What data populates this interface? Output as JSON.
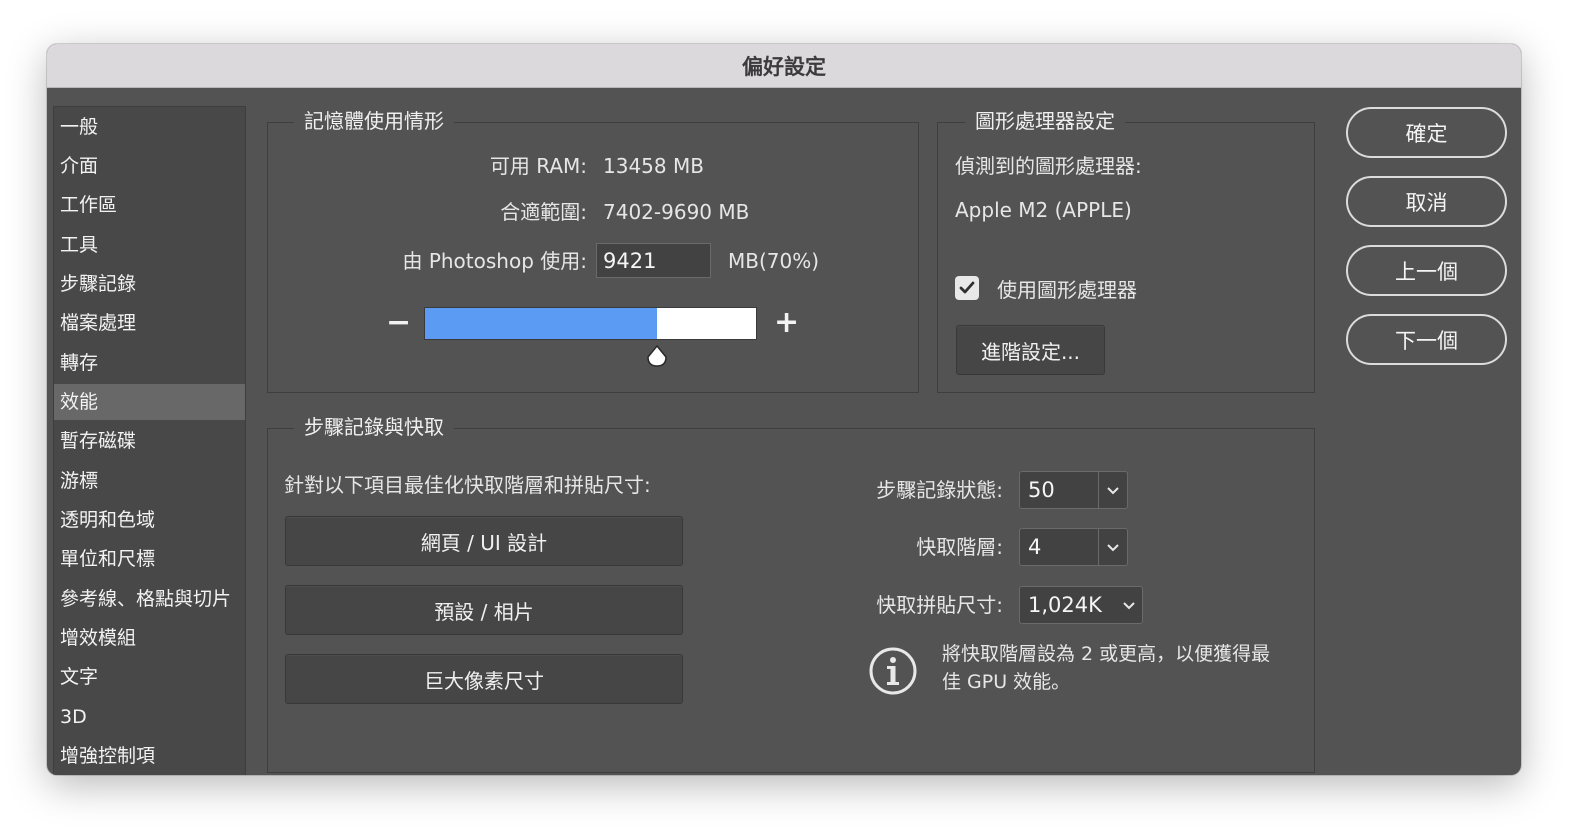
{
  "window": {
    "title": "偏好設定"
  },
  "sidebar": {
    "selected_index": 7,
    "items": [
      {
        "label": "一般"
      },
      {
        "label": "介面"
      },
      {
        "label": "工作區"
      },
      {
        "label": "工具"
      },
      {
        "label": "步驟記錄"
      },
      {
        "label": "檔案處理"
      },
      {
        "label": "轉存"
      },
      {
        "label": "效能"
      },
      {
        "label": "暫存磁碟"
      },
      {
        "label": "游標"
      },
      {
        "label": "透明和色域"
      },
      {
        "label": "單位和尺標"
      },
      {
        "label": "參考線、格點與切片"
      },
      {
        "label": "增效模組"
      },
      {
        "label": "文字"
      },
      {
        "label": "3D"
      },
      {
        "label": "增強控制項"
      }
    ]
  },
  "memory": {
    "title": "記憶體使用情形",
    "available_label": "可用 RAM:",
    "available_value": "13458 MB",
    "range_label": "合適範圍:",
    "range_value": "7402-9690 MB",
    "use_label": "由 Photoshop 使用:",
    "use_value": "9421",
    "use_suffix": "MB(70%)",
    "slider_percent": 70,
    "minus": "−",
    "plus": "+"
  },
  "gpu": {
    "title": "圖形處理器設定",
    "detected_label": "偵測到的圖形處理器:",
    "detected_value": "Apple M2 (APPLE)",
    "use_gpu_label": "使用圖形處理器",
    "use_gpu_checked": true,
    "advanced_label": "進階設定..."
  },
  "history": {
    "title": "步驟記錄與快取",
    "optimize_label": "針對以下項目最佳化快取階層和拼貼尺寸:",
    "buttons": [
      "網頁 / UI 設計",
      "預設 / 相片",
      "巨大像素尺寸"
    ],
    "states_label": "步驟記錄狀態:",
    "states_value": "50",
    "levels_label": "快取階層:",
    "levels_value": "4",
    "tile_label": "快取拼貼尺寸:",
    "tile_value": "1,024K",
    "info_line1": "將快取階層設為 2 或更高，以便獲得最",
    "info_line2": "佳 GPU 效能。"
  },
  "actions": {
    "ok": "確定",
    "cancel": "取消",
    "prev": "上一個",
    "next": "下一個"
  },
  "colors": {
    "panel_bg": "#535353",
    "slider_fill": "#5b9bf3"
  }
}
